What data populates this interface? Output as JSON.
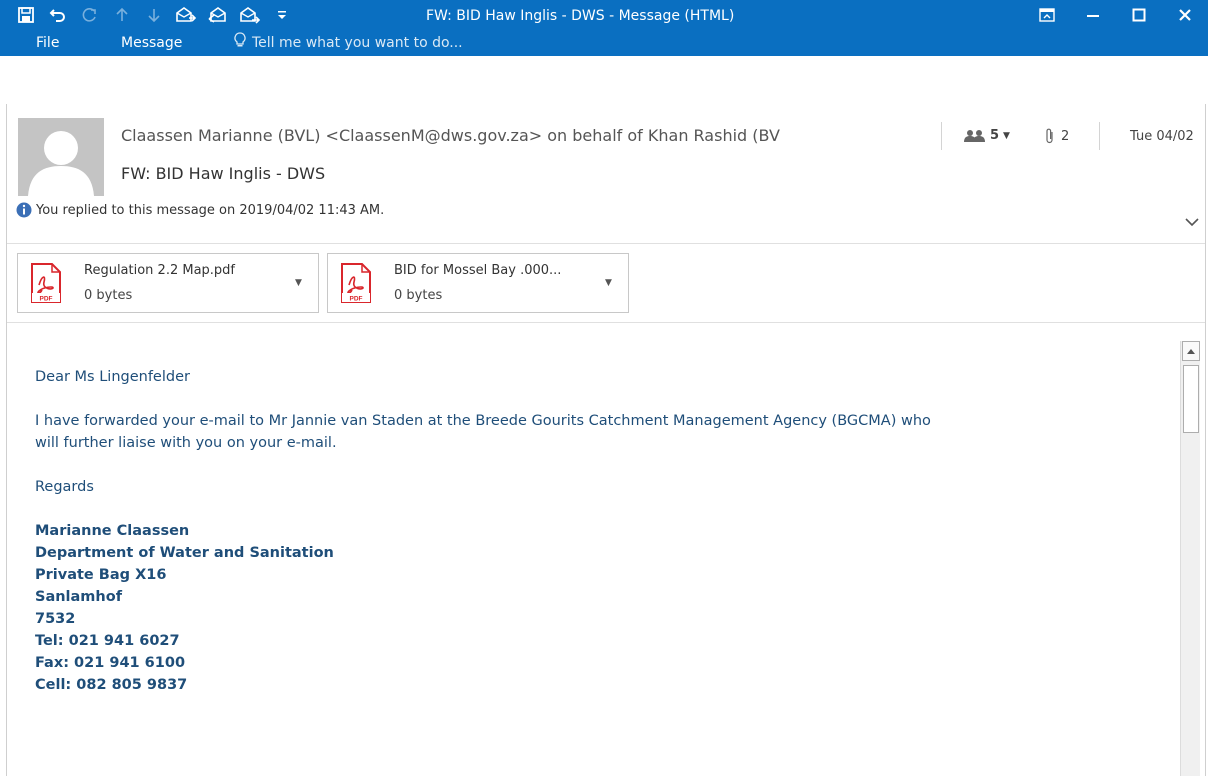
{
  "window": {
    "title": "FW: BID Haw Inglis - DWS - Message (HTML)"
  },
  "ribbon": {
    "file_label": "File",
    "message_label": "Message",
    "tell_me_placeholder": "Tell me what you want to do..."
  },
  "header": {
    "from": "Claassen Marianne (BVL) <ClaassenM@dws.gov.za> on behalf of Khan Rashid (BV",
    "subject": "FW: BID Haw Inglis - DWS",
    "people_count": "5",
    "attachment_count": "2",
    "date": "Tue 04/02",
    "info": "You replied to this message on 2019/04/02 11:43 AM."
  },
  "attachments": [
    {
      "name": "Regulation 2.2 Map.pdf",
      "size": "0 bytes"
    },
    {
      "name": "BID for Mossel Bay .000...",
      "size": "0 bytes"
    }
  ],
  "body": {
    "greeting": "Dear Ms Lingenfelder",
    "paragraph_line1": "I have forwarded your e-mail to Mr Jannie van Staden at the Breede Gourits Catchment Management Agency (BGCMA) who",
    "paragraph_line2": "will further liaise with you on your e-mail.",
    "closing": "Regards",
    "signature": {
      "name": "Marianne Claassen",
      "department": "Department of Water and Sanitation",
      "address1": "Private Bag X16",
      "address2": "Sanlamhof",
      "postcode": "7532",
      "tel": "Tel:  021 941 6027",
      "fax": "Fax:  021 941 6100",
      "cell": "Cell: 082 805 9837"
    }
  },
  "colors": {
    "title_bar": "#0a6fc1",
    "body_text": "#1f4e79",
    "pdf_red": "#d9262c"
  },
  "icons": {
    "qat": [
      "save-icon",
      "undo-icon",
      "redo-icon",
      "previous-item-icon",
      "next-item-icon",
      "reply-icon",
      "reply-all-icon",
      "forward-icon",
      "customize-qat-icon"
    ],
    "window": [
      "ribbon-display-options-icon",
      "minimize-icon",
      "maximize-icon",
      "close-icon"
    ]
  }
}
